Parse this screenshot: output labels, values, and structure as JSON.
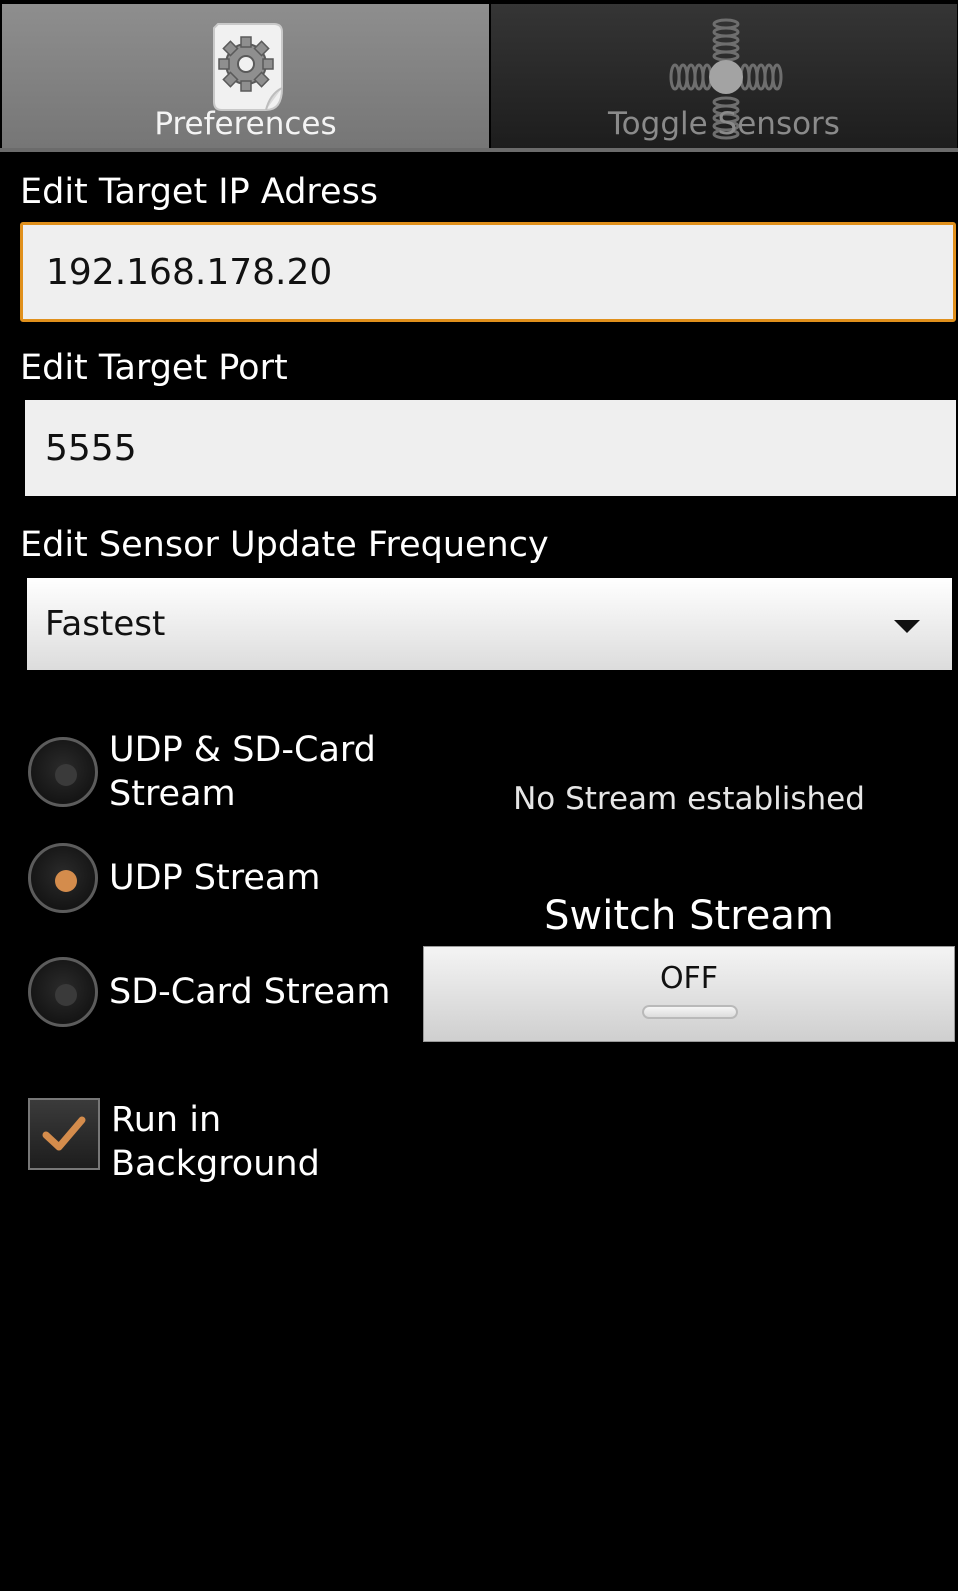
{
  "tabs": [
    {
      "label": "Preferences",
      "icon": "preferences-gear-icon",
      "selected": true
    },
    {
      "label": "Toggle Sensors",
      "icon": "sensors-springs-icon",
      "selected": false
    }
  ],
  "ip": {
    "label": "Edit Target IP Adress",
    "value": "192.168.178.20"
  },
  "port": {
    "label": "Edit Target Port",
    "value": "5555"
  },
  "frequency": {
    "label": "Edit Sensor Update Frequency",
    "selected": "Fastest"
  },
  "streams": [
    {
      "label": "UDP & SD-Card Stream",
      "checked": false
    },
    {
      "label": "UDP Stream",
      "checked": true
    },
    {
      "label": "SD-Card Stream",
      "checked": false
    }
  ],
  "status": "No Stream established",
  "switch": {
    "title": "Switch Stream",
    "state": "OFF"
  },
  "background": {
    "label": "Run in Background",
    "checked": true
  },
  "colors": {
    "accent": "#e0901c",
    "radio_checked": "#d48c4c"
  }
}
